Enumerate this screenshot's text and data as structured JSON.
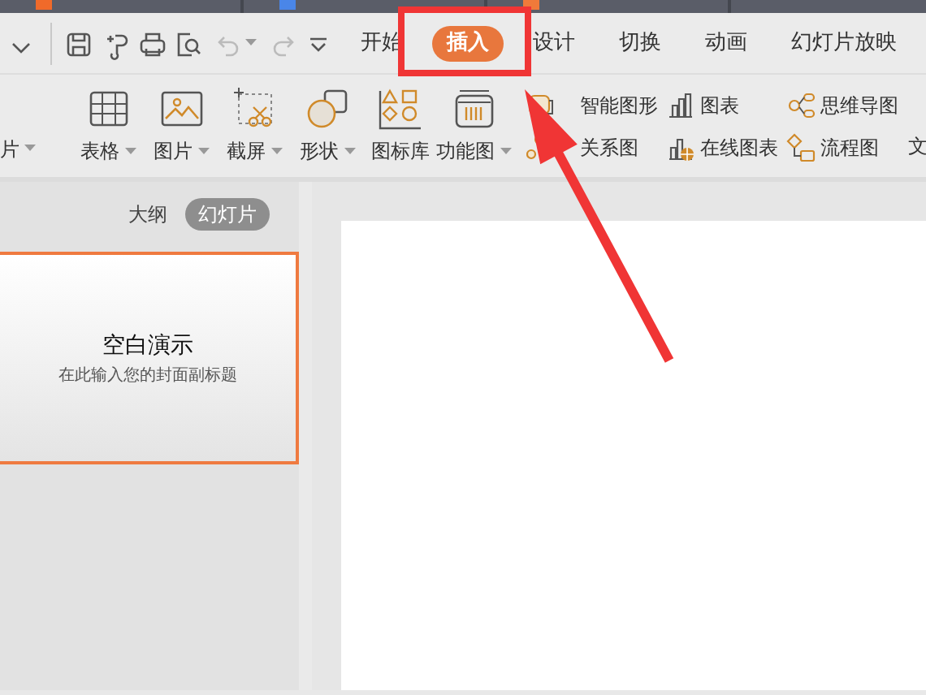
{
  "window_tabs": [
    {
      "color": "#f06a2a",
      "selected": false
    },
    {
      "color": "#4a86e8",
      "selected": false
    },
    {
      "color": "#f07a3a",
      "selected": false
    }
  ],
  "quick_access": [
    {
      "kind": "collapse",
      "disabled": false
    },
    {
      "kind": "save",
      "disabled": false
    },
    {
      "kind": "format-painter",
      "disabled": false
    },
    {
      "kind": "print",
      "disabled": false
    },
    {
      "kind": "preview",
      "disabled": false
    },
    {
      "kind": "undo",
      "disabled": true
    },
    {
      "kind": "redo",
      "disabled": true
    },
    {
      "kind": "more",
      "disabled": false
    }
  ],
  "menu_tabs": [
    {
      "label": "开始",
      "selected": false
    },
    {
      "label": "插入",
      "selected": true
    },
    {
      "label": "设计",
      "selected": false
    },
    {
      "label": "切换",
      "selected": false
    },
    {
      "label": "动画",
      "selected": false
    },
    {
      "label": "幻灯片放映",
      "selected": false
    }
  ],
  "ribbon": {
    "cut_label": "片",
    "large_buttons": [
      {
        "kind": "table",
        "label": "表格",
        "dropdown": true
      },
      {
        "kind": "picture",
        "label": "图片",
        "dropdown": true
      },
      {
        "kind": "screenshot",
        "label": "截屏",
        "dropdown": true
      },
      {
        "kind": "shape",
        "label": "形状",
        "dropdown": true
      },
      {
        "kind": "icon-library",
        "label": "图标库",
        "dropdown": false
      },
      {
        "kind": "function",
        "label": "功能图",
        "dropdown": true
      }
    ],
    "small_buttons": [
      {
        "kind": "smart",
        "label": "智能图形"
      },
      {
        "kind": "relation",
        "label": "关系图"
      },
      {
        "kind": "chart",
        "label": "图表"
      },
      {
        "kind": "online-chart",
        "label": "在线图表"
      },
      {
        "kind": "mindmap",
        "label": "思维导图"
      },
      {
        "kind": "flow",
        "label": "流程图"
      }
    ],
    "cut_end_label": "文"
  },
  "side_panel": {
    "tabs": [
      {
        "label": "大纲",
        "selected": false
      },
      {
        "label": "幻灯片",
        "selected": true
      }
    ],
    "slides": [
      {
        "title": "空白演示",
        "subtitle": "在此输入您的封面副标题",
        "selected": true
      }
    ]
  }
}
